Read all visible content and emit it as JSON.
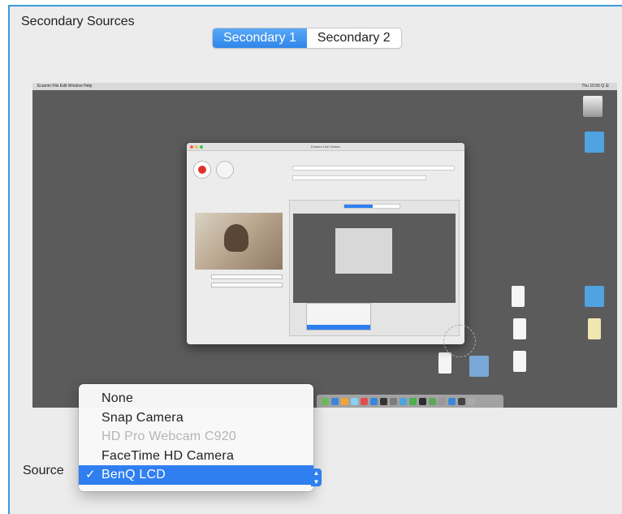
{
  "panel": {
    "title": "Secondary Sources"
  },
  "tabs": [
    {
      "label": "Secondary 1",
      "active": true
    },
    {
      "label": "Secondary 2",
      "active": false
    }
  ],
  "preview": {
    "menubar_left": "Ecamm   File   Edit   Window   Help",
    "menubar_right": "Thu 10:56   Q   ☰",
    "inner_window_title": "Ecamm Live Screen"
  },
  "source": {
    "label": "Source",
    "options": [
      {
        "label": "None",
        "disabled": false,
        "selected": false
      },
      {
        "label": "Snap Camera",
        "disabled": false,
        "selected": false
      },
      {
        "label": "HD Pro Webcam C920",
        "disabled": true,
        "selected": false
      },
      {
        "label": "FaceTime HD Camera",
        "disabled": false,
        "selected": false
      },
      {
        "label": "BenQ LCD",
        "disabled": false,
        "selected": true
      }
    ],
    "check_mark": "✓"
  },
  "colors": {
    "accent": "#2f7ff0",
    "panel_bg": "#ececec",
    "preview_bg": "#5b5b5b"
  }
}
